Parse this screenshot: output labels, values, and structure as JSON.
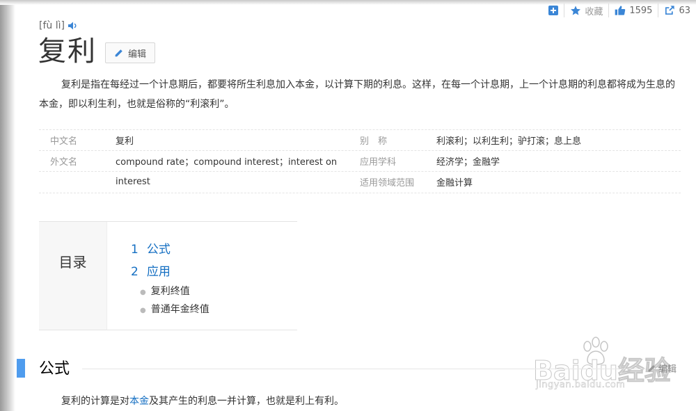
{
  "toolbar": {
    "favorite_label": "收藏",
    "like_count": "1595",
    "share_count": "63"
  },
  "entry": {
    "pinyin": "[fù lì]",
    "title": "复利",
    "edit_label": "编辑",
    "intro": "复利是指在每经过一个计息期后，都要将所生利息加入本金，以计算下期的利息。这样，在每一个计息期，上一个计息期的利息都将成为生息的本金，即以利生利，也就是俗称的“利滚利”。"
  },
  "basic_info": [
    {
      "k1": "中文名",
      "v1": "复利",
      "k2": "别　称",
      "v2": "利滚利；以利生利；驴打滚；息上息"
    },
    {
      "k1": "外文名",
      "v1": "compound rate；compound interest；interest on",
      "k2": "应用学科",
      "v2": "经济学；金融学"
    },
    {
      "k1": "",
      "v1": "interest",
      "k2": "适用领域范围",
      "v2": "金融计算"
    }
  ],
  "toc": {
    "title": "目录",
    "items": [
      {
        "num": "1",
        "label": "公式"
      },
      {
        "num": "2",
        "label": "应用"
      }
    ],
    "subitems": [
      "复利终值",
      "普通年金终值"
    ]
  },
  "section": {
    "title": "公式",
    "edit_label": "编辑",
    "para_before": "复利的计算是对",
    "para_link": "本金",
    "para_after": "及其产生的利息一并计算，也就是利上有利。"
  },
  "watermark": {
    "brand": "Baidu经验",
    "url": "jingyan.baidu.com"
  },
  "colors": {
    "link": "#136ec2",
    "section_bar": "#4f9cee",
    "tool_icon": "#3b86d6"
  }
}
